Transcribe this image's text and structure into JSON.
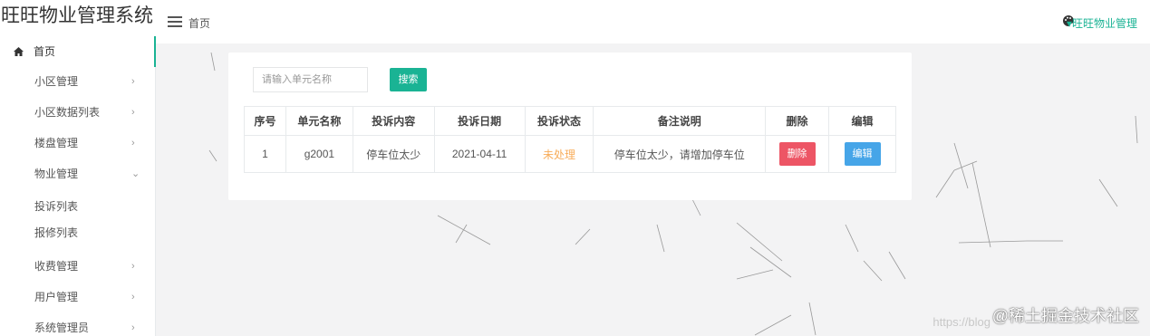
{
  "app": {
    "title": "旺旺物业管理系统"
  },
  "header": {
    "breadcrumb": "首页",
    "user_label": "旺旺物业管理",
    "menu_icon": "hamburger-icon",
    "theme_icon": "palette-icon"
  },
  "sidebar": {
    "items": [
      {
        "label": "首页",
        "icon": "home-icon",
        "active": true
      },
      {
        "label": "小区管理",
        "chevron": "›"
      },
      {
        "label": "小区数据列表",
        "chevron": "›"
      },
      {
        "label": "楼盘管理",
        "chevron": "›"
      },
      {
        "label": "物业管理",
        "chevron": "⌄",
        "expanded": true
      },
      {
        "label": "投诉列表"
      },
      {
        "label": "报修列表"
      },
      {
        "label": "收费管理",
        "chevron": "›"
      },
      {
        "label": "用户管理",
        "chevron": "›"
      },
      {
        "label": "系统管理员",
        "chevron": "›"
      }
    ]
  },
  "search": {
    "placeholder": "请输入单元名称",
    "button_label": "搜索"
  },
  "table": {
    "headers": [
      "序号",
      "单元名称",
      "投诉内容",
      "投诉日期",
      "投诉状态",
      "备注说明",
      "删除",
      "编辑"
    ],
    "rows": [
      {
        "index": "1",
        "unit": "g2001",
        "content": "停车位太少",
        "date": "2021-04-11",
        "status": "未处理",
        "note": "停车位太少，请增加停车位",
        "delete_label": "删除",
        "edit_label": "编辑"
      }
    ]
  },
  "watermark": {
    "text": "@稀土掘金技术社区",
    "url": "https://blog"
  },
  "colors": {
    "accent": "#1ab394",
    "danger": "#ed5565",
    "info": "#46a5e8",
    "warning": "#f8ac59"
  }
}
